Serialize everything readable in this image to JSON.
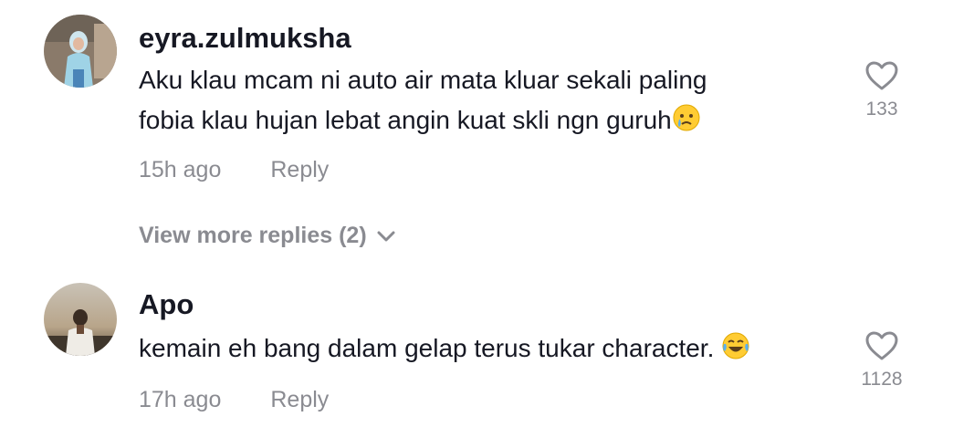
{
  "comments": [
    {
      "username": "eyra.zulmuksha",
      "text_line1": "Aku klau mcam ni auto air mata kluar sekali paling",
      "text_line2": "fobia klau hujan lebat angin kuat skli ngn guruh",
      "emoji": "crying-face",
      "time": "15h ago",
      "reply_label": "Reply",
      "like_count": "133",
      "icon": "heart-outline-icon"
    },
    {
      "username": "Apo",
      "text": "kemain eh bang dalam gelap terus tukar character.",
      "emoji": "tears-of-joy",
      "time": "17h ago",
      "reply_label": "Reply",
      "like_count": "1128",
      "icon": "heart-outline-icon"
    }
  ],
  "view_more": {
    "label": "View more replies (2)",
    "icon": "chevron-down-icon"
  }
}
